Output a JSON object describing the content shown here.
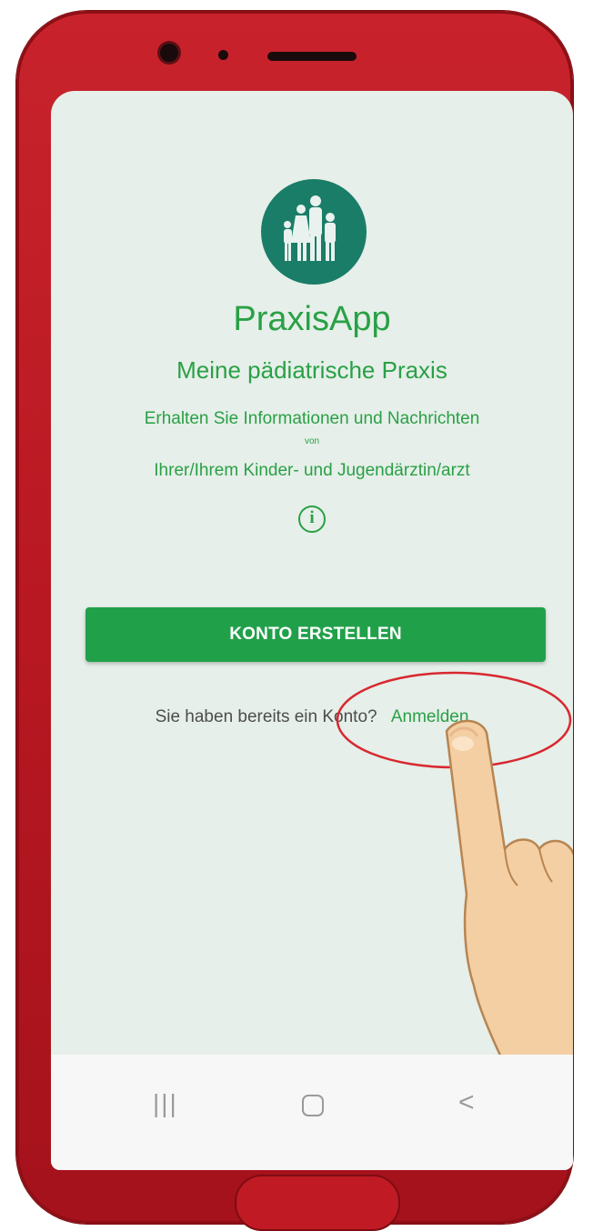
{
  "app": {
    "name": "PraxisApp",
    "subtitle": "Meine pädiatrische Praxis",
    "info_line1": "Erhalten Sie Informationen und Nachrichten",
    "info_von": "von",
    "info_line2": "Ihrer/Ihrem Kinder- und Jugendärztin/arzt"
  },
  "actions": {
    "create_account": "KONTO ERSTELLEN",
    "login_question": "Sie haben bereits ein Konto?",
    "login_link": "Anmelden"
  },
  "navbar": {
    "recent_glyph": "|||",
    "back_glyph": "<"
  },
  "icons": {
    "logo": "family-logo-icon",
    "info": "info-icon",
    "pointer": "pointing-hand-icon"
  },
  "colors": {
    "accent": "#2aa046",
    "button": "#21a04a",
    "logo_bg": "#1a7d68",
    "screen_bg": "#e6efe9",
    "phone": "#c8232c"
  }
}
